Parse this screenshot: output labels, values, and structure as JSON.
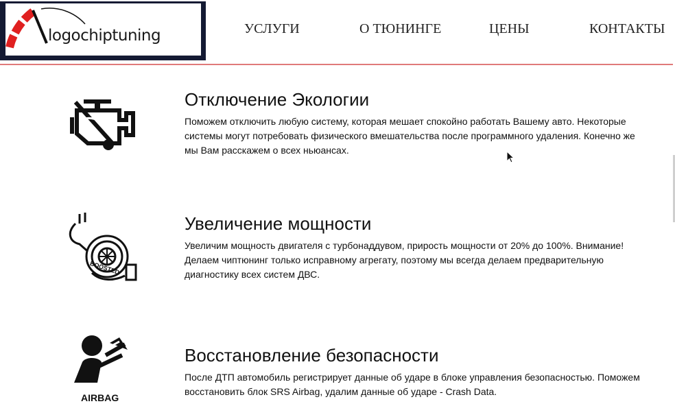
{
  "header": {
    "logo_text": "logochiptuning",
    "nav": [
      {
        "label": "УСЛУГИ"
      },
      {
        "label": "О ТЮНИНГЕ"
      },
      {
        "label": "ЦЕНЫ"
      },
      {
        "label": "КОНТАКТЫ"
      }
    ]
  },
  "services": [
    {
      "title": "Отключение Экологии",
      "description": "Поможем отключить любую систему, которая мешает спокойно работать Вашему авто. Некоторые системы могут потребовать физического вмешательства после программного удаления. Конечно же мы Вам расскажем о всех ньюансах.",
      "icon": "engine-check-icon"
    },
    {
      "title": "Увеличение мощности",
      "description": "Увеличим мощность двигателя с турбонаддувом, прирость мощности от 20% до 100%. Внимание! Делаем чиптюнинг только исправному агрегату, поэтому мы всегда делаем предварительную диагностику всех систем ДВС.",
      "icon": "turbo-icon",
      "icon_label": "BOOSTED"
    },
    {
      "title": "Восстановление безопасности",
      "description": "После ДТП автомобиль регистрирует данные об ударе в блоке управления безопасностью. Поможем восстановить блок SRS Airbag, удалим данные об ударе - Crash Data.",
      "icon": "airbag-icon",
      "icon_label": "AIRBAG"
    }
  ],
  "colors": {
    "logo_frame": "#141a33",
    "logo_accent": "#e02020",
    "header_line": "#e07a7a"
  }
}
